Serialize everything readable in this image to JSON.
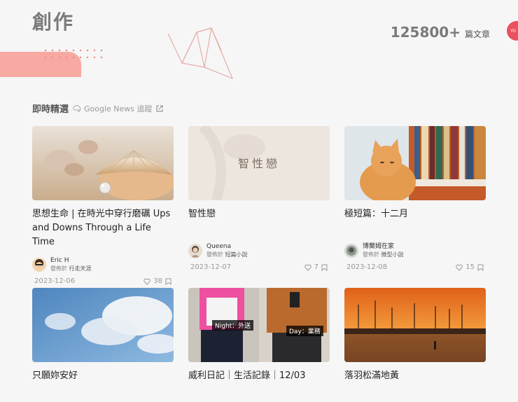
{
  "header": {
    "title": "創作",
    "count_number": "125800+",
    "count_unit": "篇文章",
    "badge_text": "YO"
  },
  "section": {
    "title": "即時精選",
    "google_news_label": "Google News 追蹤"
  },
  "colors": {
    "accent": "#f7a9a2",
    "dot": "#ef8f86",
    "badge": "#e8515d"
  },
  "cards": [
    {
      "title": "思想生命 | 在時光中穿行磨礪 Ups and Downs Through a Life Time",
      "author": "Eric H",
      "published_prefix": "發佈於",
      "published_in": "行走天涯",
      "date": "2023-12-06",
      "likes": "38"
    },
    {
      "title": "智性戀",
      "thumb_text": "智性戀",
      "author": "Queena",
      "published_prefix": "發佈於",
      "published_in": "短篇小說",
      "date": "2023-12-07",
      "likes": "7"
    },
    {
      "title": "極短篇：十二月",
      "author": "博蘭姆在家",
      "published_prefix": "發佈於",
      "published_in": "微型小說",
      "date": "2023-12-08",
      "likes": "15"
    },
    {
      "title": "只願妳安好"
    },
    {
      "title": "威利日記｜生活記錄｜12/03",
      "night_label": "Night：外送",
      "day_label": "Day：業務"
    },
    {
      "title": "落羽松滿地黃"
    }
  ]
}
